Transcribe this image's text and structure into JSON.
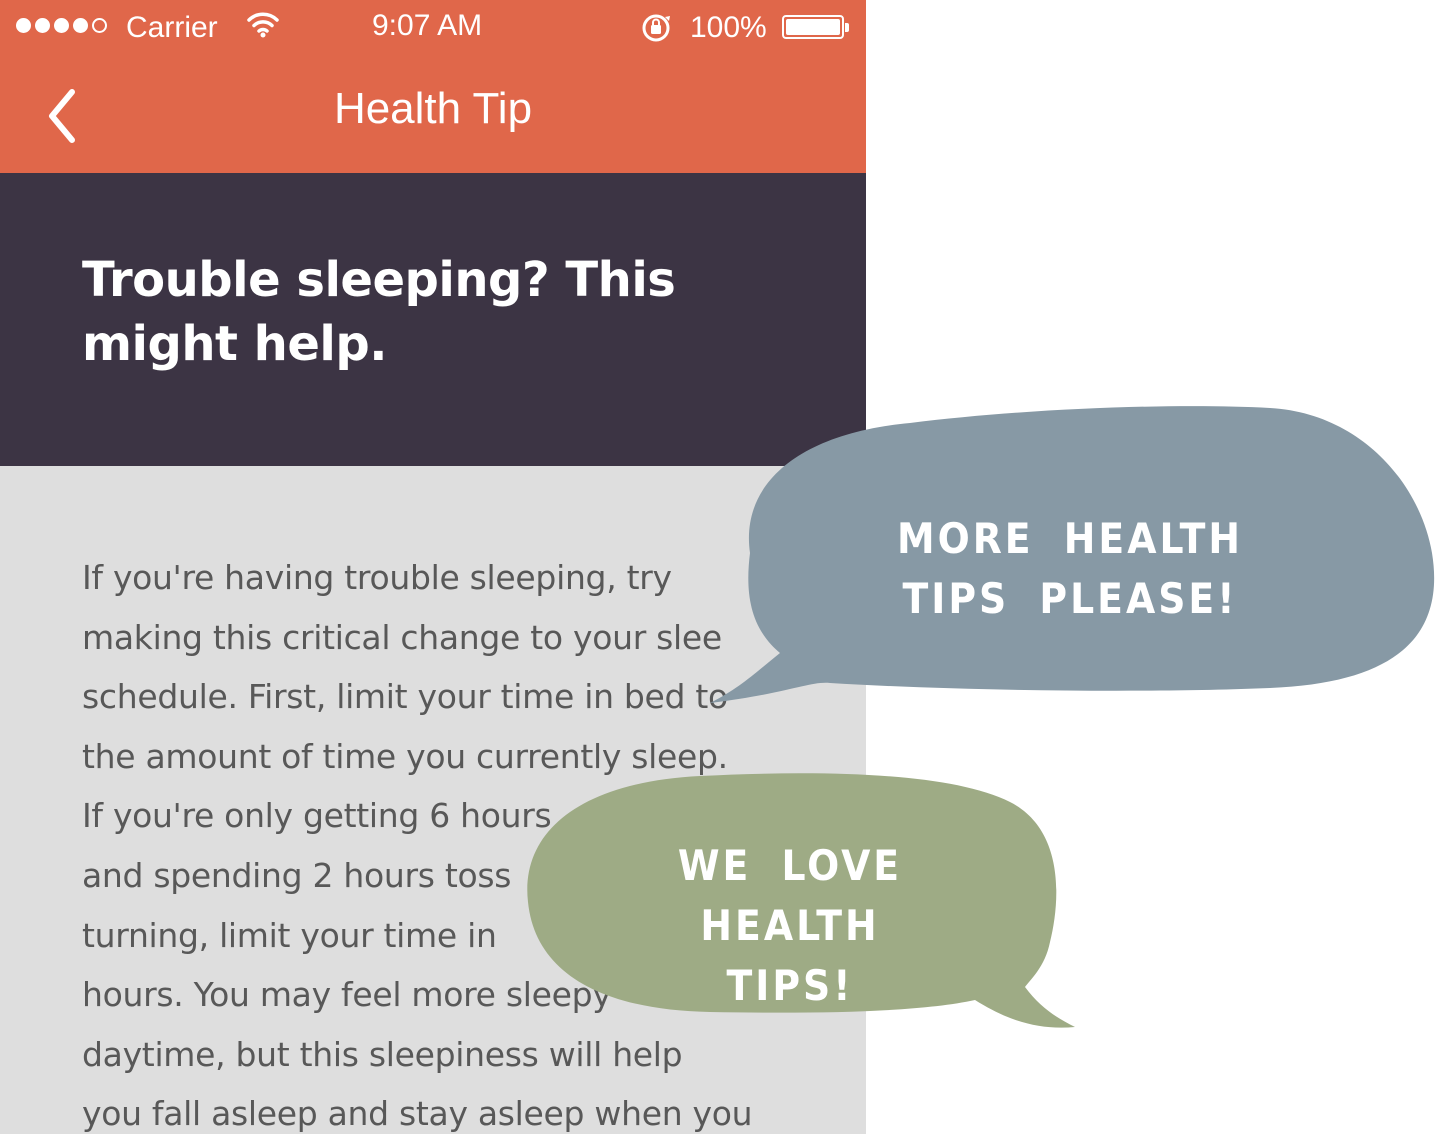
{
  "status_bar": {
    "carrier": "Carrier",
    "time": "9:07 AM",
    "battery": "100%",
    "icons": [
      "signal-dots",
      "wifi-icon",
      "rotation-lock-icon",
      "battery-icon"
    ]
  },
  "nav": {
    "title": "Health Tip",
    "back_icon": "chevron-left-icon"
  },
  "article": {
    "title": "Trouble sleeping? This might help.",
    "body_lines": [
      "If you're having trouble sleeping, try",
      "making this critical change to your slee",
      "schedule. First, limit your time in bed to",
      "the amount of time you currently sleep.",
      "If you're only getting 6 hours",
      "and spending 2 hours toss",
      "turning, limit your time in",
      "hours. You may feel more sleepy",
      "daytime, but this sleepiness will help",
      "you fall asleep and stay asleep when you"
    ]
  },
  "bubbles": [
    {
      "text": "More health tips please!",
      "color": "#8799a5"
    },
    {
      "text": "We love health tips!",
      "color": "#9eab85"
    }
  ],
  "colors": {
    "header": "#e0674a",
    "hero": "#3c3444",
    "content_bg": "#dedede"
  }
}
